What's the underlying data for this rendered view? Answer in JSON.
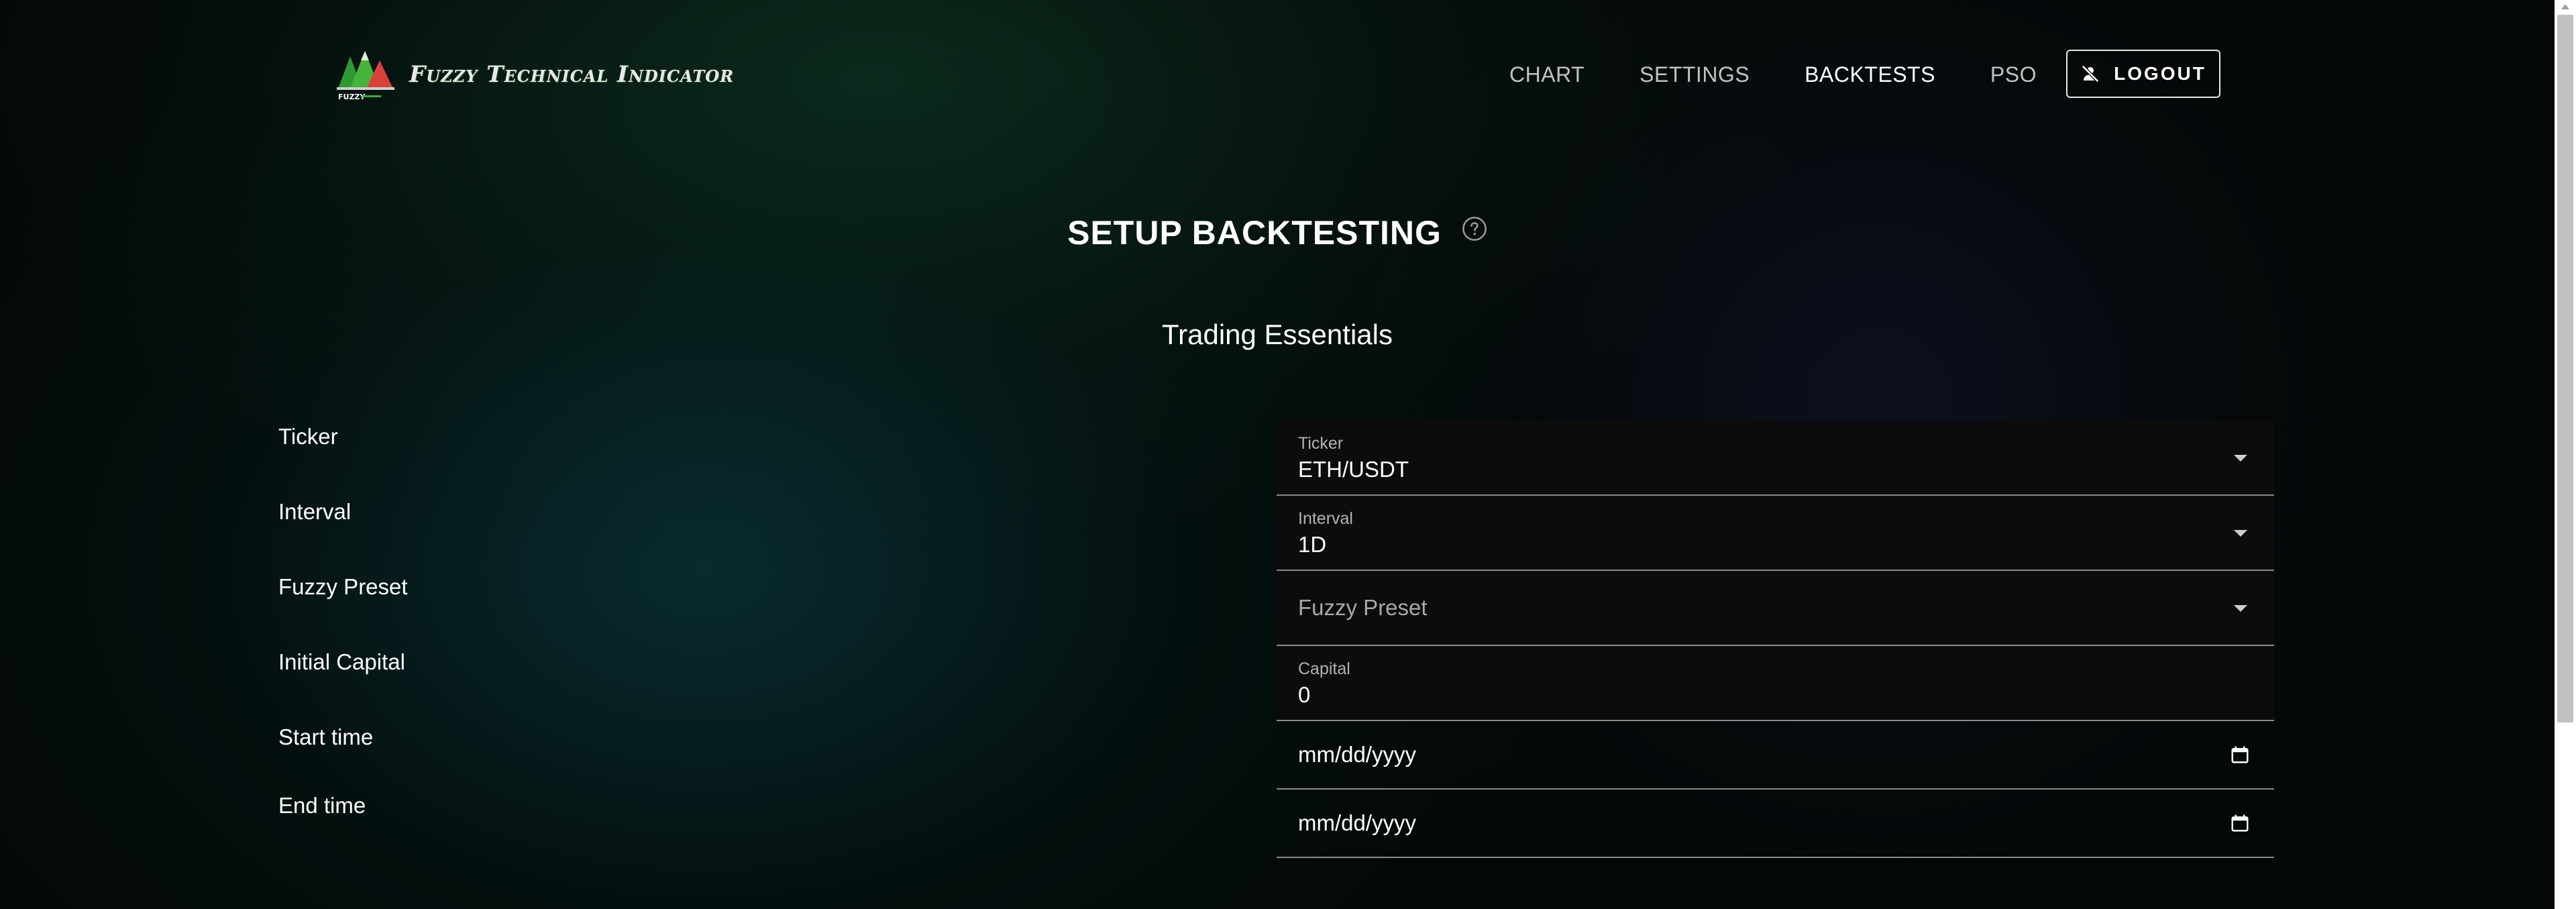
{
  "header": {
    "logo_text": "Fuzzy Technical Indicator",
    "logo_small_text": "FUZZY",
    "nav": [
      {
        "label": "CHART",
        "active": false
      },
      {
        "label": "SETTINGS",
        "active": false
      },
      {
        "label": "BACKTESTS",
        "active": true
      },
      {
        "label": "PSO",
        "active": false
      }
    ],
    "logout_label": "LOGOUT",
    "logout_icon": "no-account-icon"
  },
  "main": {
    "title": "SETUP BACKTESTING",
    "help_icon": "help-circle-icon",
    "section_title": "Trading Essentials",
    "rows": [
      {
        "label": "Ticker",
        "field_label": "Ticker",
        "value": "ETH/USDT",
        "type": "select"
      },
      {
        "label": "Interval",
        "field_label": "Interval",
        "value": "1D",
        "type": "select"
      },
      {
        "label": "Fuzzy Preset",
        "placeholder": "Fuzzy Preset",
        "type": "select-empty"
      },
      {
        "label": "Initial Capital",
        "field_label": "Capital",
        "value": "0",
        "type": "number"
      },
      {
        "label": "Start time",
        "value": "mm/dd/yyyy",
        "type": "date"
      },
      {
        "label": "End time",
        "value": "mm/dd/yyyy",
        "type": "date"
      }
    ]
  },
  "colors": {
    "field_bg": "#0c0c0c",
    "field_border": "#8a8a8a",
    "accent_green": "#3da93d",
    "accent_red": "#d9413a"
  }
}
